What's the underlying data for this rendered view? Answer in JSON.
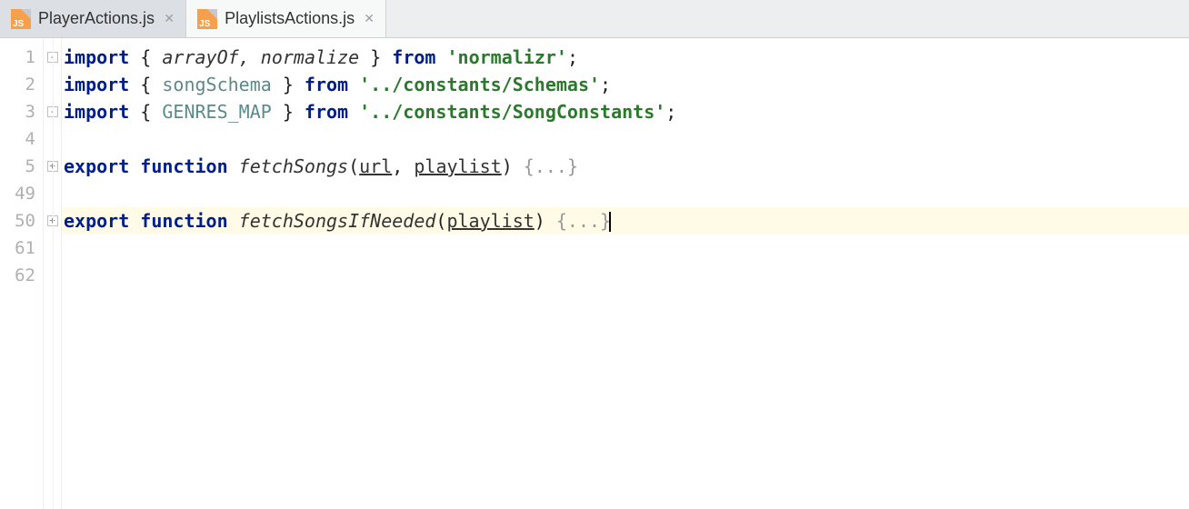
{
  "tabs": [
    {
      "label": "PlayerActions.js",
      "active": false
    },
    {
      "label": "PlaylistsActions.js",
      "active": true
    }
  ],
  "lineNumbers": [
    "1",
    "2",
    "3",
    "4",
    "5",
    "49",
    "50",
    "61",
    "62"
  ],
  "folds": [
    "-",
    "",
    "-",
    "",
    "+",
    "",
    "+",
    "",
    ""
  ],
  "code": {
    "l1": {
      "kw1": "import",
      "brace1": "{ ",
      "i1": "arrayOf",
      "comma": ", ",
      "i2": "normalize",
      "brace2": " }",
      "kw2": " from ",
      "str": "'normalizr'",
      "semi": ";"
    },
    "l2": {
      "kw1": "import",
      "brace1": " { ",
      "i1": "songSchema",
      "brace2": " }",
      "kw2": " from ",
      "str": "'../constants/Schemas'",
      "semi": ";"
    },
    "l3": {
      "kw1": "import",
      "brace1": " { ",
      "i1": "GENRES_MAP",
      "brace2": " }",
      "kw2": " from ",
      "str": "'../constants/SongConstants'",
      "semi": ";"
    },
    "l5": {
      "kw1": "export",
      "kw2": " function ",
      "fn": "fetchSongs",
      "open": "(",
      "p1": "url",
      "comma": ", ",
      "p2": "playlist",
      "close": ") ",
      "fold": "{...}"
    },
    "l50": {
      "kw1": "export",
      "kw2": " function ",
      "fn": "fetchSongsIfNeeded",
      "open": "(",
      "p1": "playlist",
      "close": ") ",
      "fold": "{...}"
    }
  }
}
